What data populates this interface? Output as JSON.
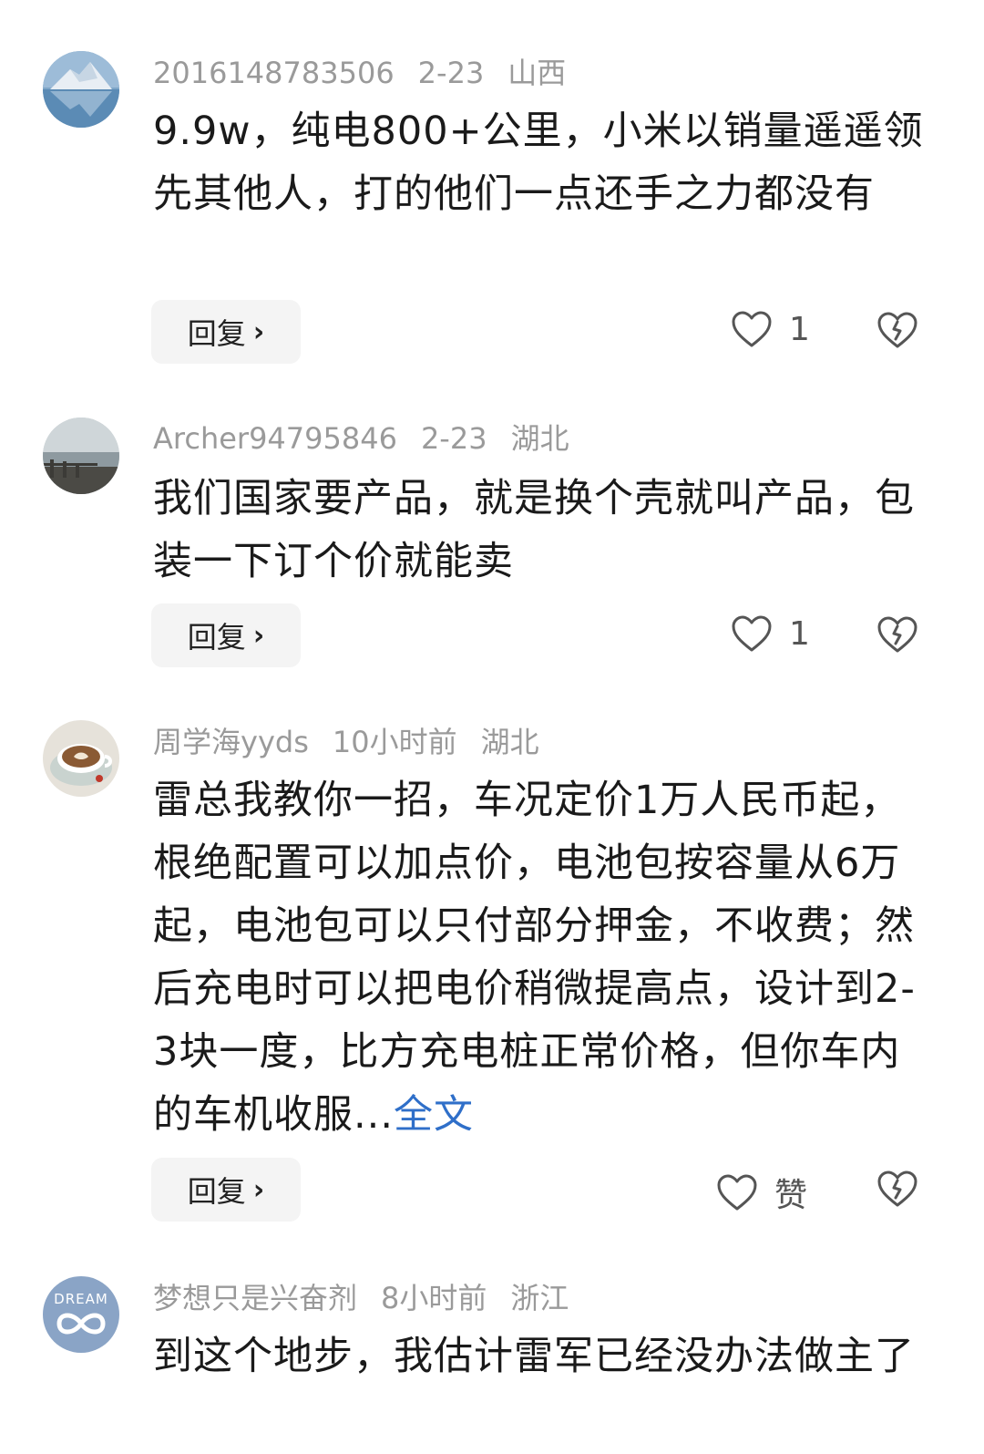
{
  "comments": [
    {
      "user": "2016148783506",
      "date": "2-23",
      "location": "山西",
      "text": "9.9w，纯电800+公里，小米以销量遥遥领先其他人，打的他们一点还手之力都没有",
      "more": "",
      "reply_label": "回复",
      "like_count": "1",
      "avatar_icon": "mountain-lake-avatar-icon"
    },
    {
      "user": "Archer94795846",
      "date": "2-23",
      "location": "湖北",
      "text": "我们国家要产品，就是换个壳就叫产品，包装一下订个价就能卖",
      "more": "",
      "reply_label": "回复",
      "like_count": "1",
      "avatar_icon": "seaside-avatar-icon"
    },
    {
      "user": "周学海yyds",
      "date": "10小时前",
      "location": "湖北",
      "text": "雷总我教你一招，车况定价1万人民币起，根绝配置可以加点价，电池包按容量从6万起，电池包可以只付部分押金，不收费；然后充电时可以把电价稍微提高点，设计到2-3块一度，比方充电桩正常价格，但你车内的车机收服...",
      "more": "全文",
      "reply_label": "回复",
      "like_count": "赞",
      "avatar_icon": "coffee-avatar-icon"
    },
    {
      "user": "梦想只是兴奋剂",
      "date": "8小时前",
      "location": "浙江",
      "text": "到这个地步，我估计雷军已经没办法做主了",
      "more": "",
      "avatar_text": "DREAM",
      "avatar_icon": "dream-infinity-avatar-icon"
    }
  ],
  "icons": {
    "like": "heart-outline-icon",
    "dislike": "broken-heart-icon",
    "reply": "chevron-right-icon"
  },
  "colors": {
    "meta": "#9a9a9a",
    "text": "#1a1a1a",
    "link": "#2f6fc9",
    "reply_bg": "#f4f4f4"
  }
}
